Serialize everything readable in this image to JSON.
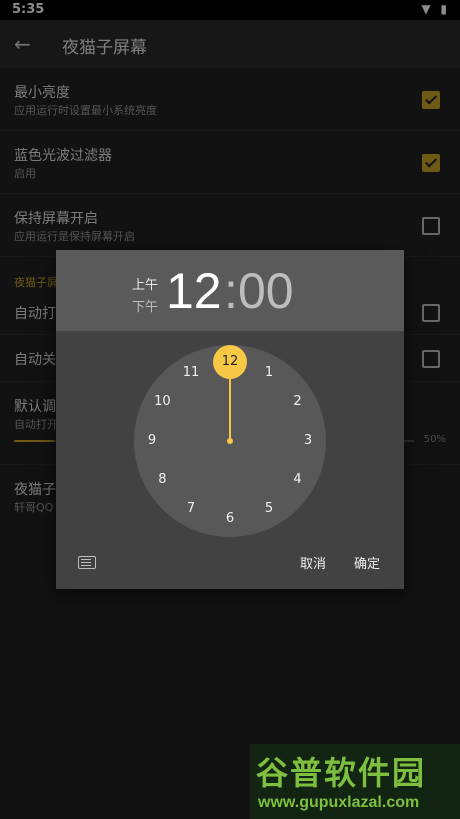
{
  "status_bar": {
    "time": "5:35",
    "icons": "▼ ▮"
  },
  "app_bar": {
    "title": "夜猫子屏幕"
  },
  "settings": [
    {
      "title": "最小亮度",
      "subtitle": "应用运行时设置最小系统亮度",
      "checked": true
    },
    {
      "title": "蓝色光波过滤器",
      "subtitle": "启用",
      "checked": true
    },
    {
      "title": "保持屏幕开启",
      "subtitle": "应用运行是保持屏幕开启",
      "checked": false
    }
  ],
  "section_label": "夜猫子屏",
  "auto_rows": [
    {
      "title": "自动打",
      "checked": false
    },
    {
      "title": "自动关",
      "checked": false
    }
  ],
  "default_row": {
    "title": "默认调",
    "subtitle": "自动打开",
    "percent": "50%",
    "level": 0.1
  },
  "about_row": {
    "title": "夜猫子",
    "subtitle": "轩哥QQ"
  },
  "time_picker": {
    "am": "上午",
    "pm": "下午",
    "hour": "12",
    "colon": ":",
    "minute": "00",
    "selected": "12",
    "numbers": [
      "1",
      "2",
      "3",
      "4",
      "5",
      "6",
      "7",
      "8",
      "9",
      "10",
      "11"
    ],
    "cancel": "取消",
    "ok": "确定"
  },
  "watermark": {
    "title": "谷普软件园",
    "url": "www.gupuxlazal.com"
  },
  "colors": {
    "accent": "#f7c846",
    "checkbox_on": "#c9a227",
    "dialog_bg": "#424242",
    "header_bg": "#5a5a5a"
  }
}
